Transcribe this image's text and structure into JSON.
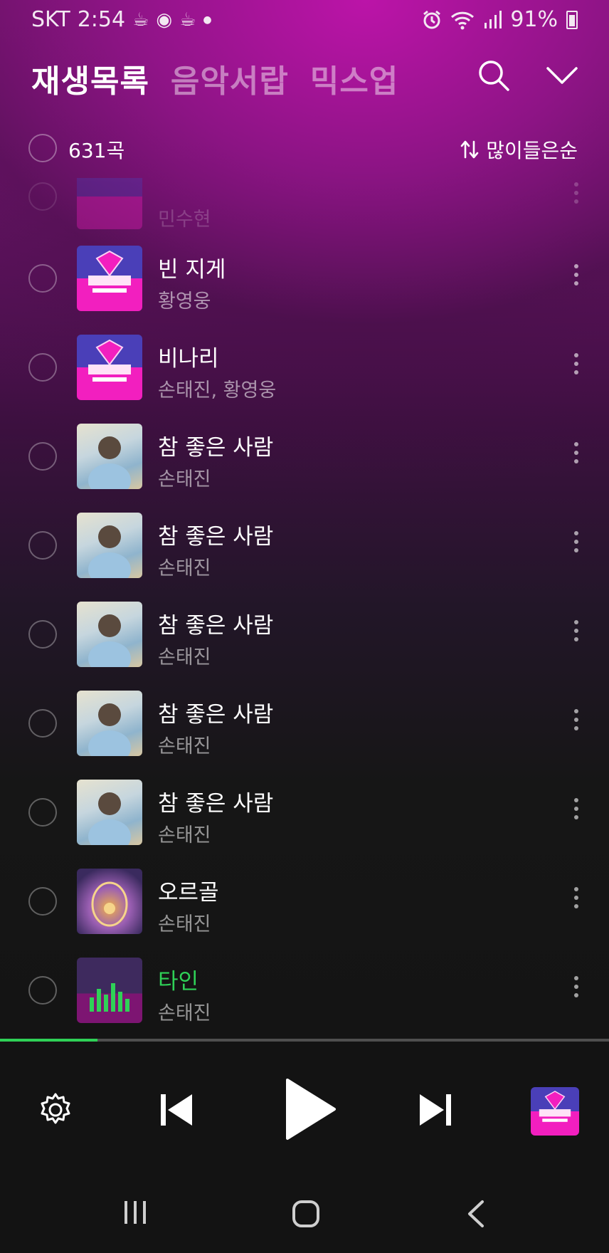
{
  "status_bar": {
    "carrier": "SKT",
    "time": "2:54",
    "battery": "91%",
    "left_icons": [
      "coffee-icon",
      "bluetooth-speaker-icon",
      "coffee-icon",
      "dot-icon"
    ],
    "right_icons": [
      "alarm-icon",
      "wifi-icon",
      "signal-icon",
      "battery-icon"
    ]
  },
  "header": {
    "tabs": [
      {
        "label": "재생목록",
        "active": true
      },
      {
        "label": "음악서랍",
        "active": false
      },
      {
        "label": "믹스업",
        "active": false
      }
    ]
  },
  "subheader": {
    "count": "631곡",
    "sort_label": "많이들은순"
  },
  "songs": [
    {
      "title": "",
      "artist": "민수현",
      "thumb": "bounce-album",
      "partially_hidden": true
    },
    {
      "title": "빈 지게",
      "artist": "황영웅",
      "thumb": "bounce-album"
    },
    {
      "title": "비나리",
      "artist": "손태진, 황영웅",
      "thumb": "bounce-album"
    },
    {
      "title": "참 좋은 사람",
      "artist": "손태진",
      "thumb": "portrait-album"
    },
    {
      "title": "참 좋은 사람",
      "artist": "손태진",
      "thumb": "portrait-album"
    },
    {
      "title": "참 좋은 사람",
      "artist": "손태진",
      "thumb": "portrait-album"
    },
    {
      "title": "참 좋은 사람",
      "artist": "손태진",
      "thumb": "portrait-album"
    },
    {
      "title": "참 좋은 사람",
      "artist": "손태진",
      "thumb": "portrait-album"
    },
    {
      "title": "오르골",
      "artist": "손태진",
      "thumb": "music-box-album"
    },
    {
      "title": "타인",
      "artist": "손태진",
      "thumb": "bounce-album-playing",
      "playing": true
    }
  ],
  "player": {
    "progress": 0.16,
    "accent_color": "#2fd157",
    "controls": [
      "gear-icon",
      "previous-icon",
      "play-icon",
      "next-icon"
    ]
  }
}
